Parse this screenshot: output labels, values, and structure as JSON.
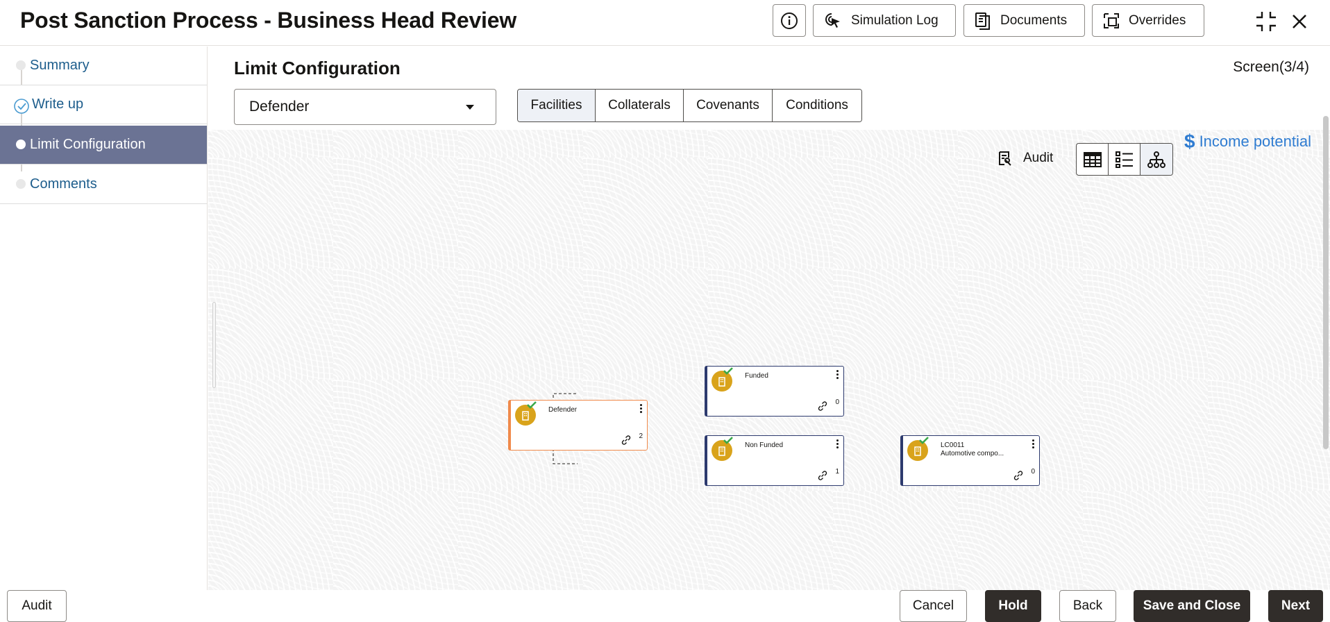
{
  "header": {
    "title": "Post Sanction Process - Business Head Review",
    "buttons": {
      "simulation_log": "Simulation Log",
      "documents": "Documents",
      "overrides": "Overrides"
    }
  },
  "sidebar": {
    "items": [
      {
        "label": "Summary"
      },
      {
        "label": "Write up"
      },
      {
        "label": "Limit Configuration"
      },
      {
        "label": "Comments"
      }
    ]
  },
  "main": {
    "section_title": "Limit Configuration",
    "screen_indicator": "Screen(3/4)",
    "party_select": "Defender",
    "tabs": [
      "Facilities",
      "Collaterals",
      "Covenants",
      "Conditions"
    ],
    "income_potential": "Income potential",
    "audit_label": "Audit",
    "tree": {
      "root": {
        "name": "Defender",
        "count": "2"
      },
      "funded": {
        "name": "Funded",
        "count": "0"
      },
      "non_funded": {
        "name": "Non Funded",
        "count": "1"
      },
      "leaf": {
        "name": "LC0011",
        "desc": "Automotive compo...",
        "count": "0"
      }
    }
  },
  "footer": {
    "audit": "Audit",
    "cancel": "Cancel",
    "hold": "Hold",
    "back": "Back",
    "save_close": "Save and Close",
    "next": "Next"
  },
  "colors": {
    "accent_link": "#2f7cd1",
    "sidebar_active": "#6b7394",
    "step_text": "#1d5d8c",
    "root_card_border": "#f08a4b",
    "card_border": "#2d3a6e",
    "avatar": "#d9a31b",
    "dark_button": "#312d2a"
  }
}
